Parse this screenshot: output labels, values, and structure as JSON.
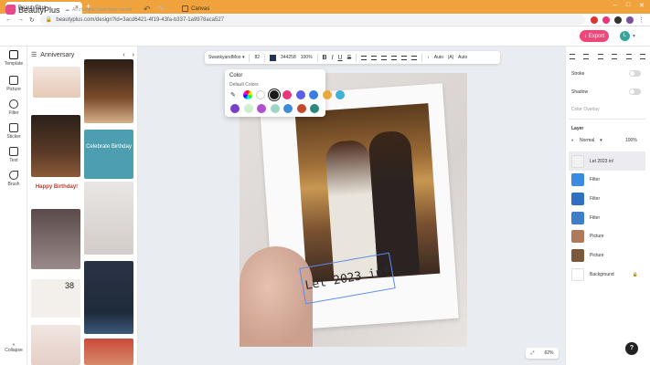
{
  "browser": {
    "tab_title": "BeautyPlus",
    "url": "beautyplus.com/design?id=3acd6421-4f19-43fa-b337-1a9978aca527"
  },
  "header": {
    "app_name": "BeautyPlus",
    "status": "All changes have been saved",
    "canvas_label": "Canvas",
    "export_label": "Export",
    "avatar_initial": "L"
  },
  "rail": {
    "items": [
      {
        "label": "Template"
      },
      {
        "label": "Picture"
      },
      {
        "label": "Filter"
      },
      {
        "label": "Sticker"
      },
      {
        "label": "Text"
      },
      {
        "label": "Brush"
      }
    ],
    "collapse_label": "Collapse"
  },
  "panel": {
    "title": "Anniversary",
    "thumb_captions": {
      "happy_birthday": "Happy Birthday!",
      "celebrate": "Celebrate Birthday",
      "number": "38"
    }
  },
  "toolbar": {
    "font": "SwankyandMoo",
    "size": "82",
    "color_hex": "344258",
    "opacity": "100%",
    "bold": "B",
    "auto1": "Auto",
    "auto2": "Auto"
  },
  "color_popup": {
    "title": "Color",
    "subtitle": "Default Colors",
    "swatches_row1": [
      "#ffffff",
      "#1a1a1a",
      "#e9357c",
      "#5b5fe6",
      "#3b7de0",
      "#e8a93a",
      "#3fb2d9"
    ],
    "swatches_row2": [
      "#7a3fc8",
      "#cfeed0",
      "#b14fcf",
      "#9ed6c2",
      "#3e8bd6",
      "#c24a2a",
      "#2a8a7a"
    ]
  },
  "canvas": {
    "caption_text": "Let 2023 in!",
    "zoom": "62%"
  },
  "right_panel": {
    "stroke_label": "Stroke",
    "shadow_label": "Shadow",
    "color_overlay_label": "Color Overlay",
    "layer_title": "Layer",
    "blend_mode": "Normal",
    "opacity": "100%",
    "layers": [
      {
        "name": "Let 2023 in!",
        "color": "#f1f1f1"
      },
      {
        "name": "Filter",
        "color": "#3b8be0"
      },
      {
        "name": "Filter",
        "color": "#2f6fc4"
      },
      {
        "name": "Filter",
        "color": "#3e7fc8"
      },
      {
        "name": "Picture",
        "color": "#b07a5a"
      },
      {
        "name": "Picture",
        "color": "#7a5a3a"
      },
      {
        "name": "Background",
        "color": "#ffffff"
      }
    ]
  },
  "help_label": "?"
}
